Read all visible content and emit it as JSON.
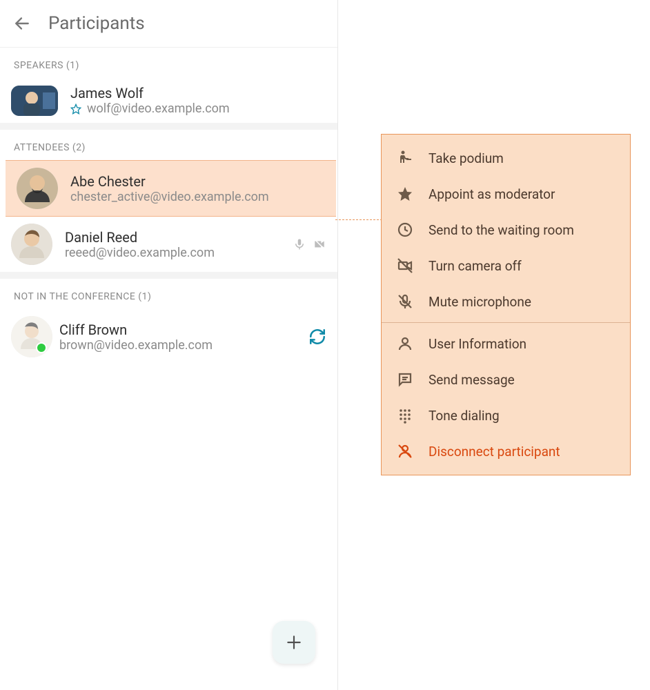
{
  "header": {
    "title": "Participants"
  },
  "sections": {
    "speakers": {
      "label": "SPEAKERS (1)",
      "items": [
        {
          "name": "James Wolf",
          "email": "wolf@video.example.com"
        }
      ]
    },
    "attendees": {
      "label": "ATTENDEES (2)",
      "items": [
        {
          "name": "Abe Chester",
          "email": "chester_active@video.example.com"
        },
        {
          "name": "Daniel Reed",
          "email": "reeed@video.example.com"
        }
      ]
    },
    "absent": {
      "label": "NOT IN THE CONFERENCE (1)",
      "items": [
        {
          "name": "Cliff Brown",
          "email": "brown@video.example.com"
        }
      ]
    }
  },
  "menu": {
    "take_podium": "Take podium",
    "appoint_moderator": "Appoint as moderator",
    "send_waiting": "Send to the waiting room",
    "camera_off": "Turn camera off",
    "mute_mic": "Mute microphone",
    "user_info": "User Information",
    "send_message": "Send message",
    "tone_dialing": "Tone dialing",
    "disconnect": "Disconnect participant"
  }
}
